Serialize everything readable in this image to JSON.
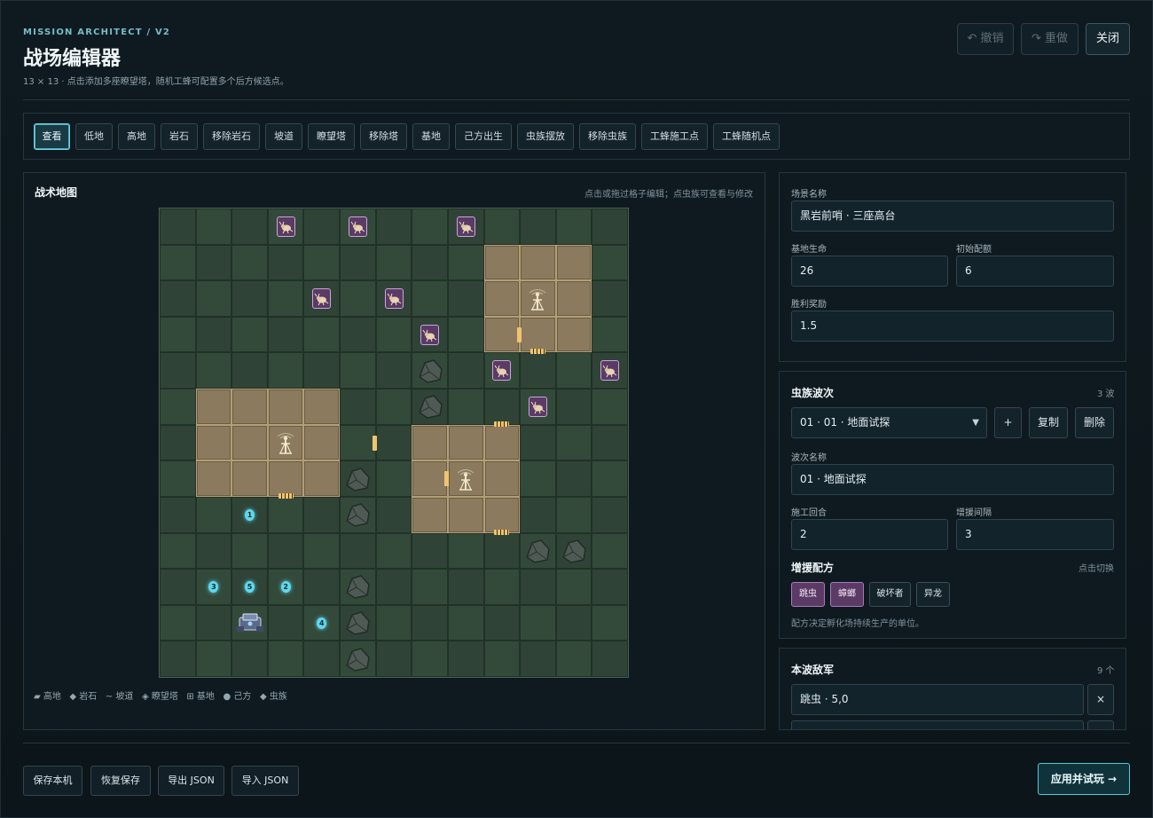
{
  "header": {
    "kicker": "MISSION ARCHITECT / V2",
    "title": "战场编辑器",
    "subtitle": "13 × 13 · 点击添加多座瞭望塔，随机工蜂可配置多个后方候选点。",
    "undo_label": "↶ 撤销",
    "redo_label": "↷ 重做",
    "close_label": "关闭"
  },
  "toolbar": {
    "tools": [
      "查看",
      "低地",
      "高地",
      "岩石",
      "移除岩石",
      "坡道",
      "瞭望塔",
      "移除塔",
      "基地",
      "己方出生",
      "虫族摆放",
      "移除虫族",
      "工蜂施工点",
      "工蜂随机点"
    ],
    "active": "查看"
  },
  "map": {
    "title": "战术地图",
    "hint": "点击或拖过格子编辑；点虫族可查看与修改",
    "grid_size": 13,
    "high_cells": [
      [
        9,
        1
      ],
      [
        10,
        1
      ],
      [
        11,
        1
      ],
      [
        9,
        2
      ],
      [
        10,
        2
      ],
      [
        11,
        2
      ],
      [
        9,
        3
      ],
      [
        10,
        3
      ],
      [
        11,
        3
      ],
      [
        1,
        5
      ],
      [
        2,
        5
      ],
      [
        3,
        5
      ],
      [
        4,
        5
      ],
      [
        1,
        6
      ],
      [
        2,
        6
      ],
      [
        3,
        6
      ],
      [
        4,
        6
      ],
      [
        1,
        7
      ],
      [
        2,
        7
      ],
      [
        3,
        7
      ],
      [
        4,
        7
      ],
      [
        7,
        6
      ],
      [
        8,
        6
      ],
      [
        9,
        6
      ],
      [
        7,
        7
      ],
      [
        8,
        7
      ],
      [
        9,
        7
      ],
      [
        7,
        8
      ],
      [
        8,
        8
      ],
      [
        9,
        8
      ]
    ],
    "rocks": [
      [
        7,
        4
      ],
      [
        7,
        5
      ],
      [
        5,
        7
      ],
      [
        5,
        8
      ],
      [
        10,
        9
      ],
      [
        11,
        9
      ],
      [
        5,
        10
      ],
      [
        5,
        11
      ],
      [
        5,
        12
      ]
    ],
    "towers": [
      [
        10,
        2
      ],
      [
        3,
        6
      ],
      [
        8,
        7
      ]
    ],
    "ramps_horizontal": [
      [
        10,
        3
      ],
      [
        9,
        5
      ],
      [
        3,
        7
      ],
      [
        9,
        8
      ]
    ],
    "ramps_vertical": [
      [
        9,
        3
      ],
      [
        5,
        6
      ],
      [
        7,
        7
      ]
    ],
    "zerg": [
      [
        3,
        0
      ],
      [
        5,
        0
      ],
      [
        8,
        0
      ],
      [
        4,
        2
      ],
      [
        6,
        2
      ],
      [
        7,
        3
      ],
      [
        9,
        4
      ],
      [
        12,
        4
      ],
      [
        10,
        5
      ]
    ],
    "base": [
      2,
      11
    ],
    "worker_points": [
      {
        "label": "1",
        "cell": [
          2,
          8
        ]
      },
      {
        "label": "2",
        "cell": [
          3,
          10
        ]
      },
      {
        "label": "3",
        "cell": [
          1,
          10
        ]
      },
      {
        "label": "4",
        "cell": [
          4,
          11
        ]
      },
      {
        "label": "5",
        "cell": [
          2,
          10
        ]
      }
    ],
    "legend": [
      "▰ 高地",
      "◆ 岩石",
      "~ 坡道",
      "◈ 瞭望塔",
      "⊞ 基地",
      "● 己方",
      "◆ 虫族"
    ]
  },
  "scenario": {
    "name_label": "场景名称",
    "name_value": "黑岩前哨 · 三座高台",
    "base_hp_label": "基地生命",
    "base_hp_value": "26",
    "init_label": "初始配额",
    "init_value": "6",
    "reward_label": "胜利奖励",
    "reward_value": "1.5"
  },
  "waves": {
    "title": "虫族波次",
    "count": "3 波",
    "selected": "01 · 01 · 地面试探",
    "add_label": "+",
    "copy_label": "复制",
    "delete_label": "删除",
    "wave_name_label": "波次名称",
    "wave_name_value": "01 · 地面试探",
    "build_label": "施工回合",
    "build_value": "2",
    "reinforce_label": "增援间隔",
    "reinforce_value": "3",
    "recipe_title": "增援配方",
    "recipe_hint": "点击切换",
    "recipe": [
      {
        "label": "跳虫",
        "on": true
      },
      {
        "label": "蟑螂",
        "on": true
      },
      {
        "label": "破坏者",
        "on": false
      },
      {
        "label": "异龙",
        "on": false
      }
    ],
    "recipe_note": "配方决定孵化场持续生产的单位。"
  },
  "enemies": {
    "title": "本波敌军",
    "count": "9 个",
    "first": "跳虫 · 5,0",
    "remove_label": "×"
  },
  "footer": {
    "save_label": "保存本机",
    "restore_label": "恢复保存",
    "export_label": "导出 JSON",
    "import_label": "导入 JSON",
    "apply_label": "应用并试玩 →"
  },
  "colors": {
    "accent": "#6fd1de",
    "high_ground": "#8b7a5d",
    "low_ground": "#2f4437",
    "zerg": "#5c3a66",
    "ramp": "#e8b860"
  }
}
